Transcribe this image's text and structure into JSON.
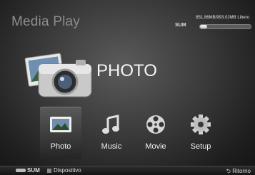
{
  "app": {
    "title": "Media Play"
  },
  "storage": {
    "text": "851.86MB/993.02MB Libero",
    "device": "SUM",
    "used_fraction": 0.14
  },
  "hero": {
    "label": "PHOTO",
    "icon": "photo-camera-icon"
  },
  "menu": {
    "selected": "Photo",
    "items": [
      {
        "label": "Photo",
        "icon": "photo-icon"
      },
      {
        "label": "Music",
        "icon": "music-note-icon"
      },
      {
        "label": "Movie",
        "icon": "film-reel-icon"
      },
      {
        "label": "Setup",
        "icon": "gear-icon"
      }
    ]
  },
  "footer": {
    "device": "SUM",
    "source": "Dispositivo",
    "back": "Ritorno"
  }
}
